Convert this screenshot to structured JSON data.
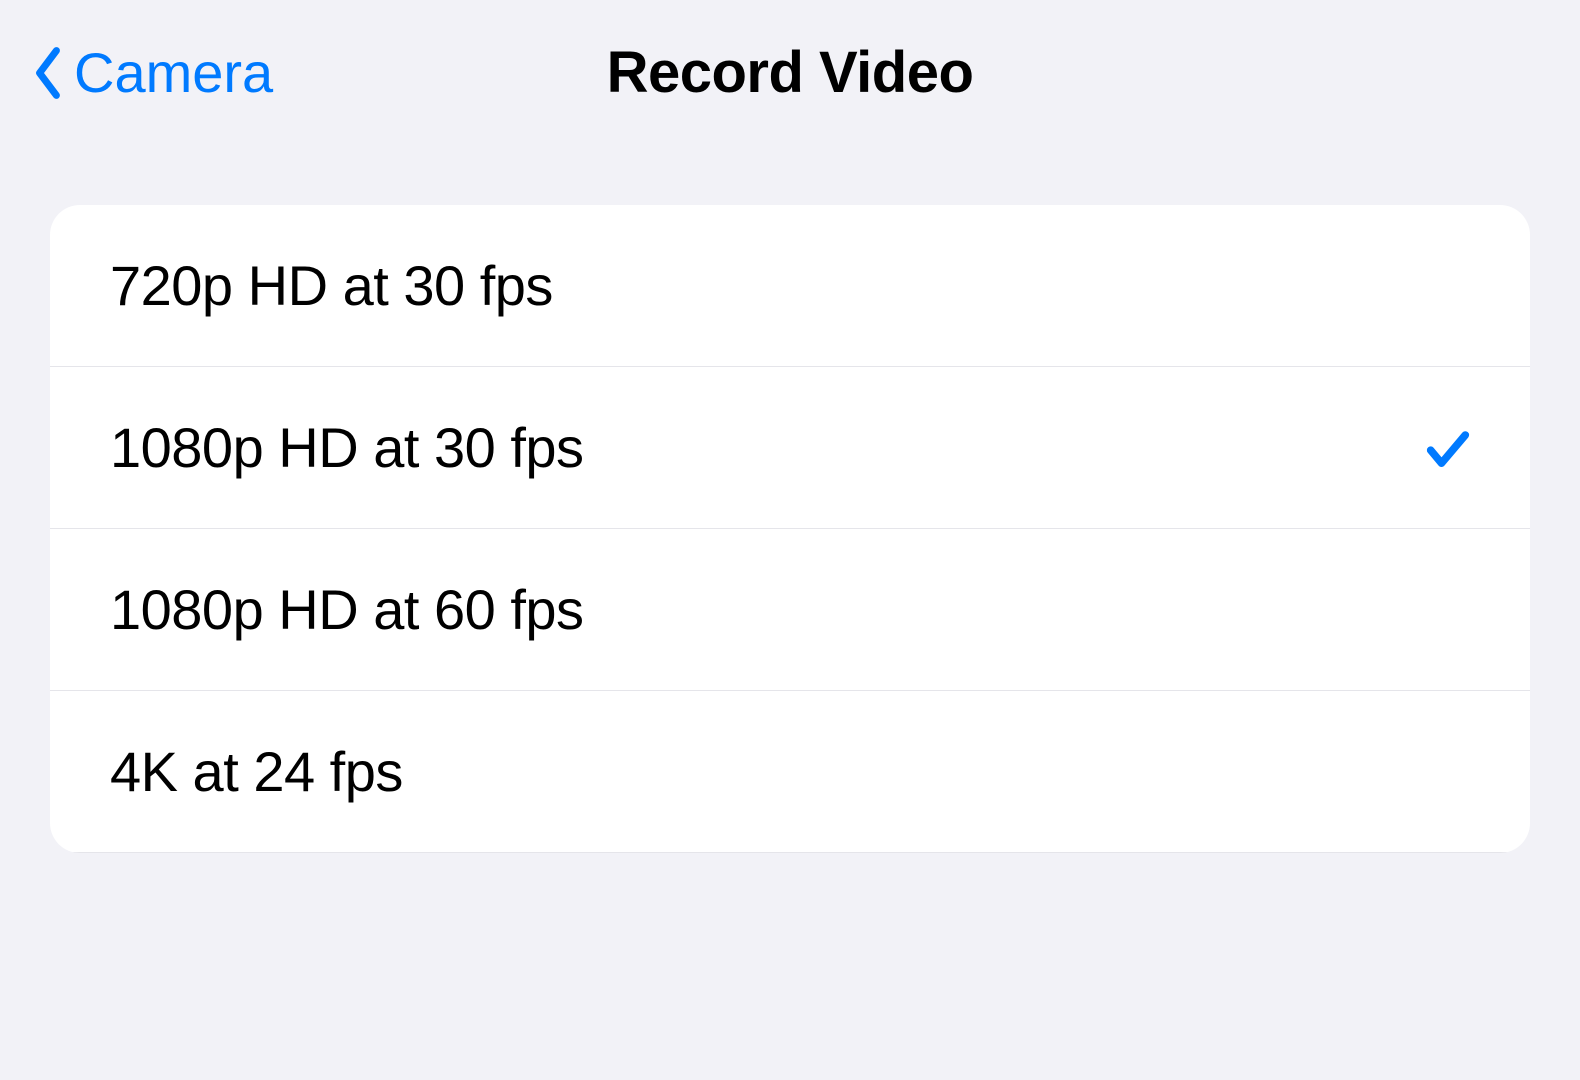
{
  "header": {
    "back_label": "Camera",
    "title": "Record Video"
  },
  "colors": {
    "accent": "#007aff",
    "background": "#f2f2f7",
    "card": "#ffffff",
    "separator": "#e5e5ea",
    "text": "#000000"
  },
  "options": [
    {
      "label": "720p HD at 30 fps",
      "selected": false
    },
    {
      "label": "1080p HD at 30 fps",
      "selected": true
    },
    {
      "label": "1080p HD at 60 fps",
      "selected": false
    },
    {
      "label": "4K at 24 fps",
      "selected": false
    }
  ]
}
